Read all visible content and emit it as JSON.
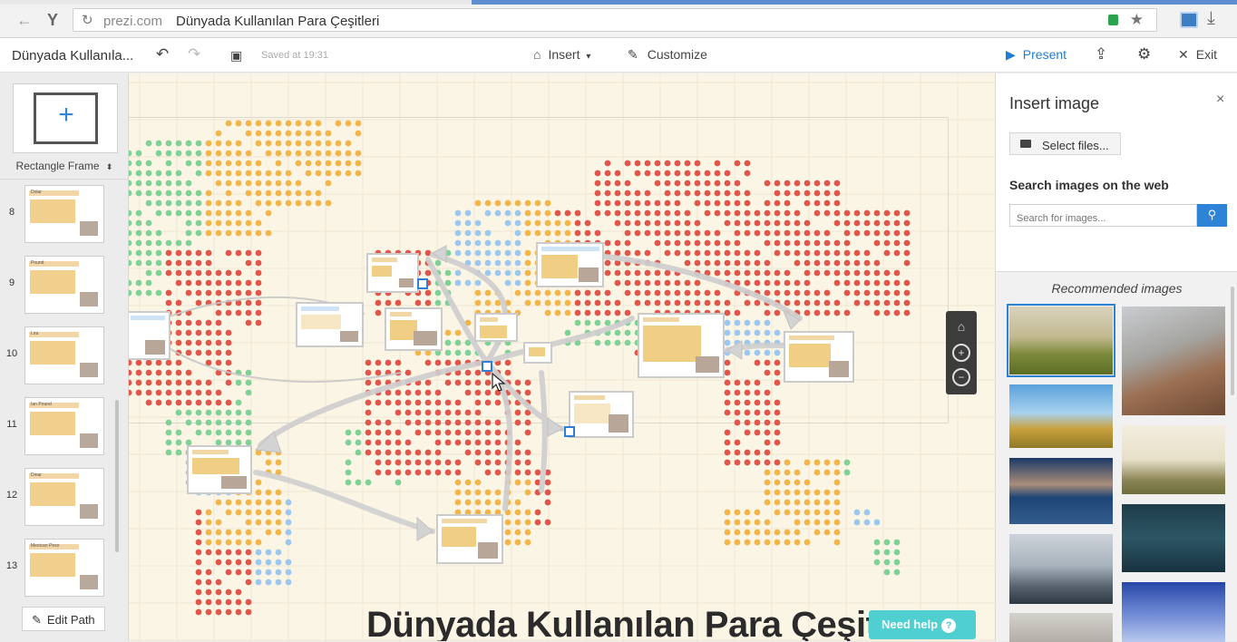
{
  "browser": {
    "domain": "prezi.com",
    "page_title": "Dünyada Kullanılan Para Çeşitleri"
  },
  "toolbar": {
    "doc_title": "Dünyada Kullanıla...",
    "saved": "Saved at 19:31",
    "insert_label": "Insert",
    "customize_label": "Customize",
    "present_label": "Present",
    "exit_label": "Exit"
  },
  "left_panel": {
    "frame_label": "Rectangle Frame",
    "edit_path": "Edit Path",
    "slides": [
      {
        "num": "8",
        "header": "Dolar"
      },
      {
        "num": "9",
        "header": "Pound"
      },
      {
        "num": "10",
        "header": "Lira"
      },
      {
        "num": "11",
        "header": "Ian Pound"
      },
      {
        "num": "12",
        "header": "Dinar"
      },
      {
        "num": "13",
        "header": "Mexican Peso"
      }
    ]
  },
  "canvas": {
    "title": "Dünyada Kullanılan Para Çeşitl",
    "need_help": "Need help",
    "colors": {
      "red": "#e0564a",
      "orange": "#f2b54a",
      "green": "#7fd196",
      "blue": "#9cc7ee"
    }
  },
  "right_panel": {
    "title": "Insert image",
    "select_files": "Select files...",
    "search_label": "Search images on the web",
    "search_placeholder": "Search for images...",
    "recommended_label": "Recommended images"
  }
}
